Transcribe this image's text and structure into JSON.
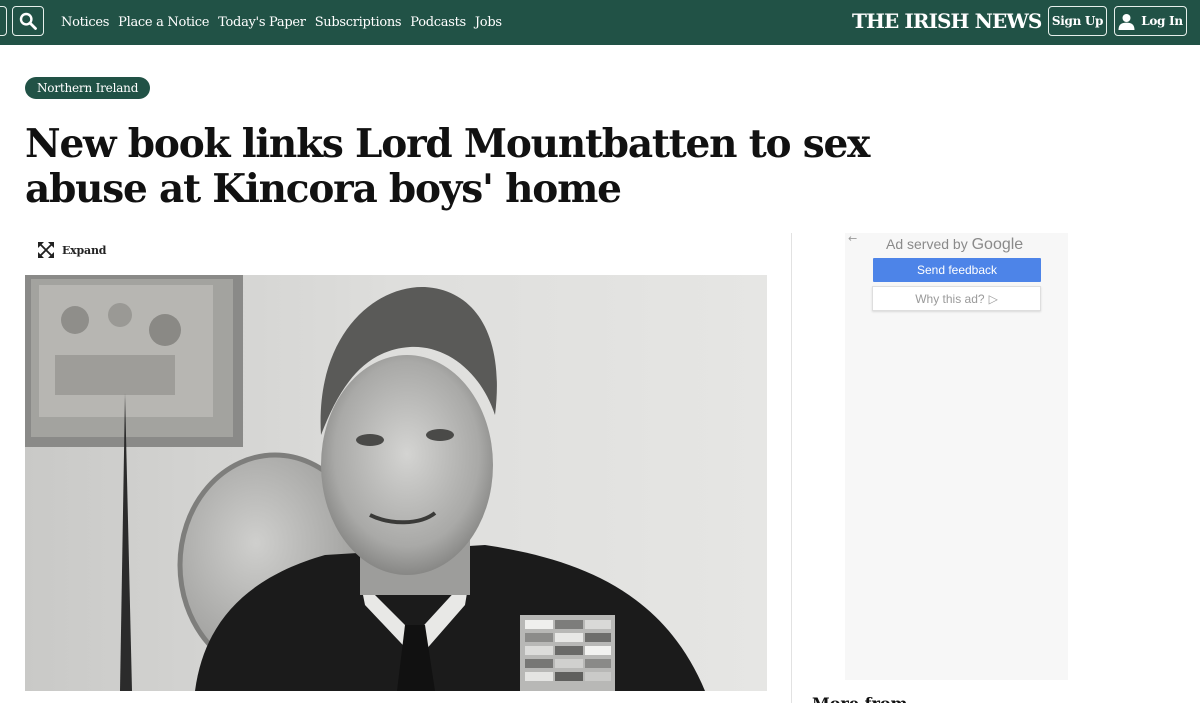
{
  "nav": {
    "links": [
      "Notices",
      "Place a Notice",
      "Today's Paper",
      "Subscriptions",
      "Podcasts",
      "Jobs"
    ],
    "logo": "THE IRISH NEWS",
    "signup": "Sign Up",
    "login": "Log In"
  },
  "article": {
    "section": "Northern Ireland",
    "headline": "New book links Lord Mountbatten to sex abuse at Kincora boys' home",
    "expand_label": "Expand"
  },
  "ad": {
    "back_arrow": "←",
    "served_by": "Ad served by",
    "served_brand": "Google",
    "send_feedback": "Send feedback",
    "why_this_ad": "Why this ad?",
    "why_icon": "▷"
  },
  "sidebar": {
    "heading": "More from"
  },
  "colors": {
    "brand_green": "#215246",
    "feedback_blue": "#4d84e8"
  },
  "icons": [
    "search-icon",
    "user-icon",
    "expand-icon",
    "back-arrow-icon",
    "play-triangle-icon"
  ]
}
